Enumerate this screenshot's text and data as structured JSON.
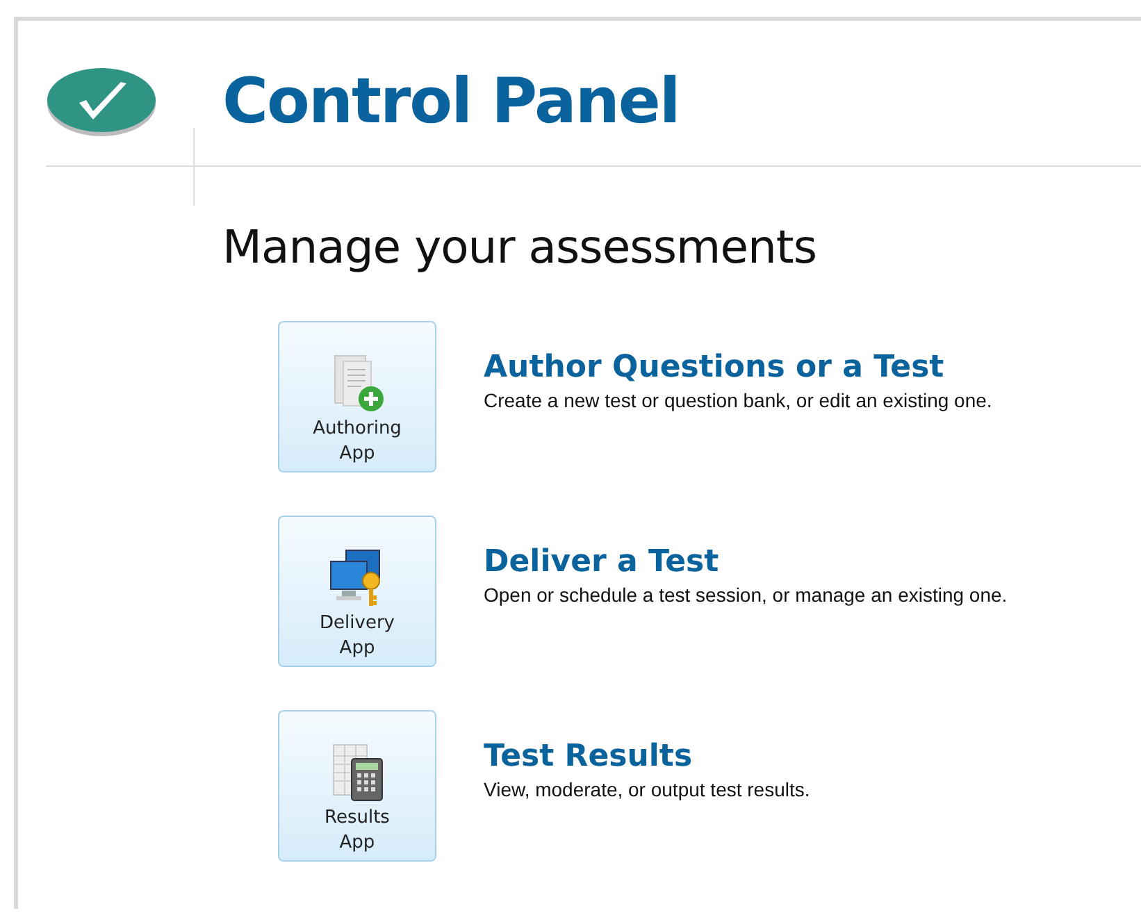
{
  "header": {
    "title": "Control Panel"
  },
  "heading": "Manage your assessments",
  "apps": [
    {
      "kind": "authoring",
      "button_lines": [
        "Authoring",
        "App"
      ],
      "title": "Author Questions or a Test",
      "description": "Create a new test or question bank, or edit an existing one."
    },
    {
      "kind": "delivery",
      "button_lines": [
        "Delivery",
        "App"
      ],
      "title": "Deliver a Test",
      "description": "Open or schedule a test session, or manage an existing one."
    },
    {
      "kind": "results",
      "button_lines": [
        "Results",
        "App"
      ],
      "title": "Test Results",
      "description": "View, moderate, or output test results."
    }
  ]
}
